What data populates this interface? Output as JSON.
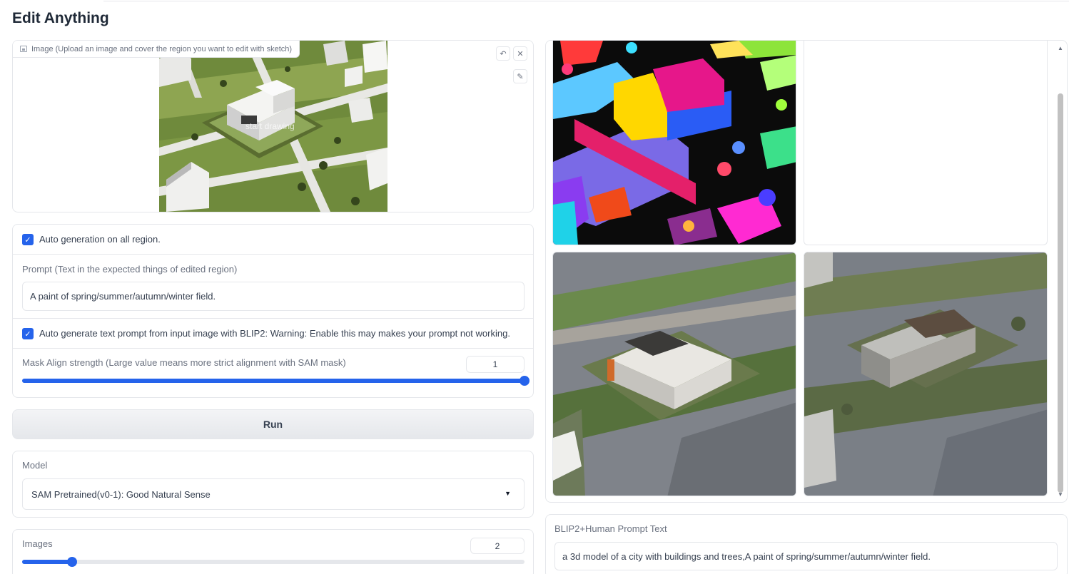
{
  "app": {
    "title": "Edit Anything"
  },
  "image_editor": {
    "label": "Image (Upload an image and cover the region you want to edit with sketch)",
    "overlay_text": "start drawing",
    "icons": {
      "undo": "undo-icon",
      "clear": "close-icon",
      "brush": "brush-icon"
    }
  },
  "settings": {
    "auto_generation": {
      "label": "Auto generation on all region.",
      "checked": true
    },
    "prompt": {
      "label": "Prompt (Text in the expected things of edited region)",
      "value": "A paint of spring/summer/autumn/winter field."
    },
    "auto_blip": {
      "label": "Auto generate text prompt from input image with BLIP2: Warning: Enable this may makes your prompt not working.",
      "checked": true
    },
    "mask_align": {
      "label": "Mask Align strength (Large value means more strict alignment with SAM mask)",
      "value": "1",
      "fraction": 1.0
    }
  },
  "run": {
    "label": "Run"
  },
  "model": {
    "label": "Model",
    "selected": "SAM Pretrained(v0-1): Good Natural Sense"
  },
  "images": {
    "label": "Images",
    "value": "2",
    "fraction": 0.1
  },
  "blip": {
    "label": "BLIP2+Human Prompt Text",
    "value": "a 3d model of a city with buildings and trees,A paint of spring/summer/autumn/winter field."
  },
  "colors": {
    "accent": "#2563eb",
    "border": "#e5e7eb"
  }
}
